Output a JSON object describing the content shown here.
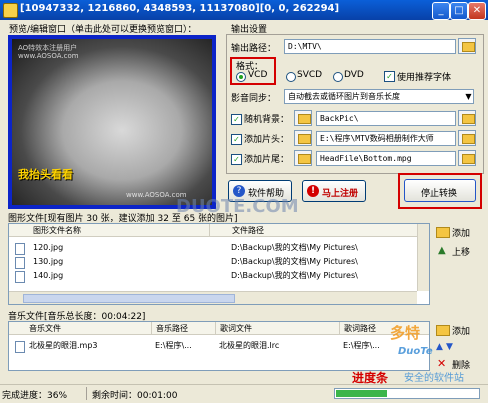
{
  "window": {
    "title": "[10947332, 1216860, 4348593, 11137080][0, 0, 262294]"
  },
  "preview": {
    "label": "预览/编辑窗口（单击此处可以更换预览窗口）：",
    "caption": "我抬头看看",
    "watermark_top": "AO特效本注册用户",
    "watermark_sub": "www.AOSOA.com",
    "watermark_bottom": "www.AOSOA.com"
  },
  "output": {
    "section_label": "输出设置",
    "path_label": "输出路径：",
    "path_value": "D:\\MTV\\",
    "format_label": "格式：",
    "formats": [
      "VCD",
      "SVCD",
      "DVD"
    ],
    "selected_format": "VCD",
    "recommend_font_label": "使用推荐字体",
    "sync_label": "影音同步：",
    "sync_value": "自动截去或循环图片到音乐长度",
    "random_bg_label": "随机背景：",
    "random_bg_value": "BackPic\\",
    "add_head_label": "添加片头：",
    "add_head_value": "E:\\程序\\MTV数码相册制作大师",
    "add_tail_label": "添加片尾：",
    "add_tail_value": "HeadFile\\Bottom.mpg"
  },
  "buttons": {
    "help": "软件帮助",
    "register": "马上注册",
    "stop": "停止转换"
  },
  "images": {
    "section_label": "图形文件[现有图片 30 张，建议添加 32 至 65 张的图片]",
    "columns": [
      "图形文件名称",
      "文件路径"
    ],
    "rows": [
      {
        "name": "120.jpg",
        "path": "D:\\Backup\\我的文档\\My Pictures\\"
      },
      {
        "name": "130.jpg",
        "path": "D:\\Backup\\我的文档\\My Pictures\\"
      },
      {
        "name": "140.jpg",
        "path": "D:\\Backup\\我的文档\\My Pictures\\"
      }
    ],
    "add_label": "添加",
    "up_label": "上移"
  },
  "music": {
    "section_label": "音乐文件[音乐总长度：00:04:22]",
    "columns": [
      "音乐文件",
      "音乐路径",
      "歌词文件",
      "歌词路径"
    ],
    "rows": [
      {
        "file": "北极星的眼泪.mp3",
        "path": "E:\\程序\\...",
        "lyric": "北极星的眼泪.lrc",
        "lyric_path": "E:\\程序\\..."
      }
    ],
    "add_label": "添加",
    "delete_label": "删除"
  },
  "status": {
    "progress_label": "完成进度：36%",
    "remaining_label": "剩余时间：00:01:00",
    "progress": 0.36
  },
  "annotation": {
    "progress_bar_note": "进度条"
  },
  "site_watermark": {
    "brand_cn": "多特",
    "brand_en": "DuoTe",
    "slogan": "安全的软件站",
    "center": "DUOTE.COM"
  },
  "colors": {
    "title_bar": "#0a5fd8",
    "highlight_red": "#d40000",
    "progress_green": "#3bb54a"
  }
}
